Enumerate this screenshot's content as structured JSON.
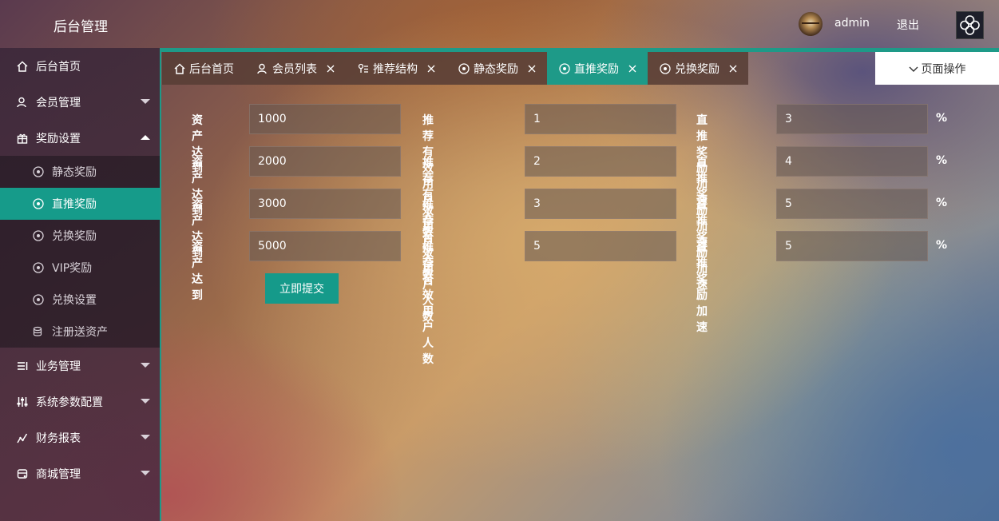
{
  "header": {
    "title": "后台管理",
    "username": "admin",
    "logout_label": "退出"
  },
  "sidebar": {
    "items": [
      {
        "label": "后台首页",
        "icon": "home-icon"
      },
      {
        "label": "会员管理",
        "icon": "user-icon",
        "expandable": true
      },
      {
        "label": "奖励设置",
        "icon": "gift-icon",
        "expanded": true,
        "children": [
          {
            "label": "静态奖励",
            "icon": "gear-icon"
          },
          {
            "label": "直推奖励",
            "icon": "gear-icon",
            "active": true
          },
          {
            "label": "兑换奖励",
            "icon": "gear-icon"
          },
          {
            "label": "VIP奖励",
            "icon": "gear-icon"
          },
          {
            "label": "兑换设置",
            "icon": "gear-icon"
          },
          {
            "label": "注册送资产",
            "icon": "database-icon"
          }
        ]
      },
      {
        "label": "业务管理",
        "icon": "list-icon",
        "expandable": true
      },
      {
        "label": "系统参数配置",
        "icon": "sliders-icon",
        "expandable": true
      },
      {
        "label": "财务报表",
        "icon": "chart-icon",
        "expandable": true
      },
      {
        "label": "商城管理",
        "icon": "shop-icon",
        "expandable": true
      }
    ]
  },
  "tabs": [
    {
      "label": "后台首页",
      "icon": "home-icon",
      "closable": false
    },
    {
      "label": "会员列表",
      "icon": "user-icon",
      "closable": true
    },
    {
      "label": "推荐结构",
      "icon": "tree-icon",
      "closable": true
    },
    {
      "label": "静态奖励",
      "icon": "gear-icon",
      "closable": true
    },
    {
      "label": "直推奖励",
      "icon": "gear-icon",
      "closable": true,
      "active": true
    },
    {
      "label": "兑换奖励",
      "icon": "gear-icon",
      "closable": true
    }
  ],
  "page_ops_label": "页面操作",
  "form": {
    "asset_label": "资产达到",
    "referral_label": "推荐有效用户人数",
    "speedup_label": "直推奖励加速",
    "percent_sign": "%",
    "rows": [
      {
        "asset": "1000",
        "referrals": "1",
        "speedup": "3"
      },
      {
        "asset": "2000",
        "referrals": "2",
        "speedup": "4"
      },
      {
        "asset": "3000",
        "referrals": "3",
        "speedup": "5"
      },
      {
        "asset": "5000",
        "referrals": "5",
        "speedup": "5"
      }
    ],
    "submit_label": "立即提交"
  },
  "colors": {
    "accent": "#1e9a88",
    "sidebar_bg": "#3a2838"
  }
}
